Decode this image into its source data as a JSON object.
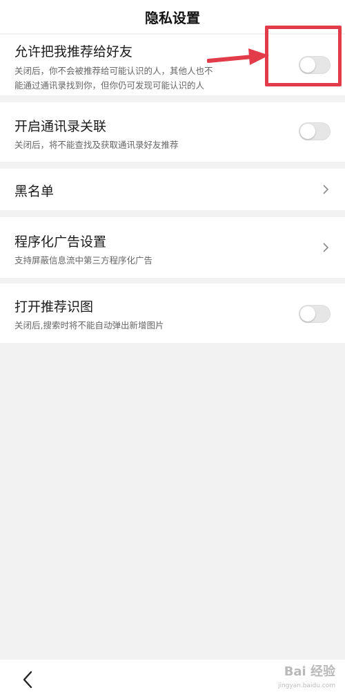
{
  "header": {
    "title": "隐私设置"
  },
  "settings": [
    {
      "title": "允许把我推荐给好友",
      "desc_line1": "关闭后，你不会被推荐给可能认识的人，其他人也不",
      "desc_line2": "能通过通讯录找到你，但你仍可发现可能认识的人",
      "control": "toggle",
      "state": "off"
    },
    {
      "title": "开启通讯录关联",
      "desc": "关闭后，将不能查找及获取通讯录好友推荐",
      "control": "toggle",
      "state": "off"
    },
    {
      "title": "黑名单",
      "control": "chevron"
    },
    {
      "title": "程序化广告设置",
      "desc": "支持屏蔽信息流中第三方程序化广告",
      "control": "chevron"
    },
    {
      "title": "打开推荐识图",
      "desc": "关闭后,搜索时将不能自动弹出新增图片",
      "control": "toggle",
      "state": "off"
    }
  ],
  "watermark": {
    "main": "Bai 经验",
    "sub": "jingyan.baidu.com"
  },
  "colors": {
    "highlight": "#e23b49",
    "toggle_off": "#e6e6e6",
    "background": "#f2f2f2"
  },
  "icons": {
    "back": "chevron-left-icon",
    "row_arrow": "chevron-right-icon"
  }
}
